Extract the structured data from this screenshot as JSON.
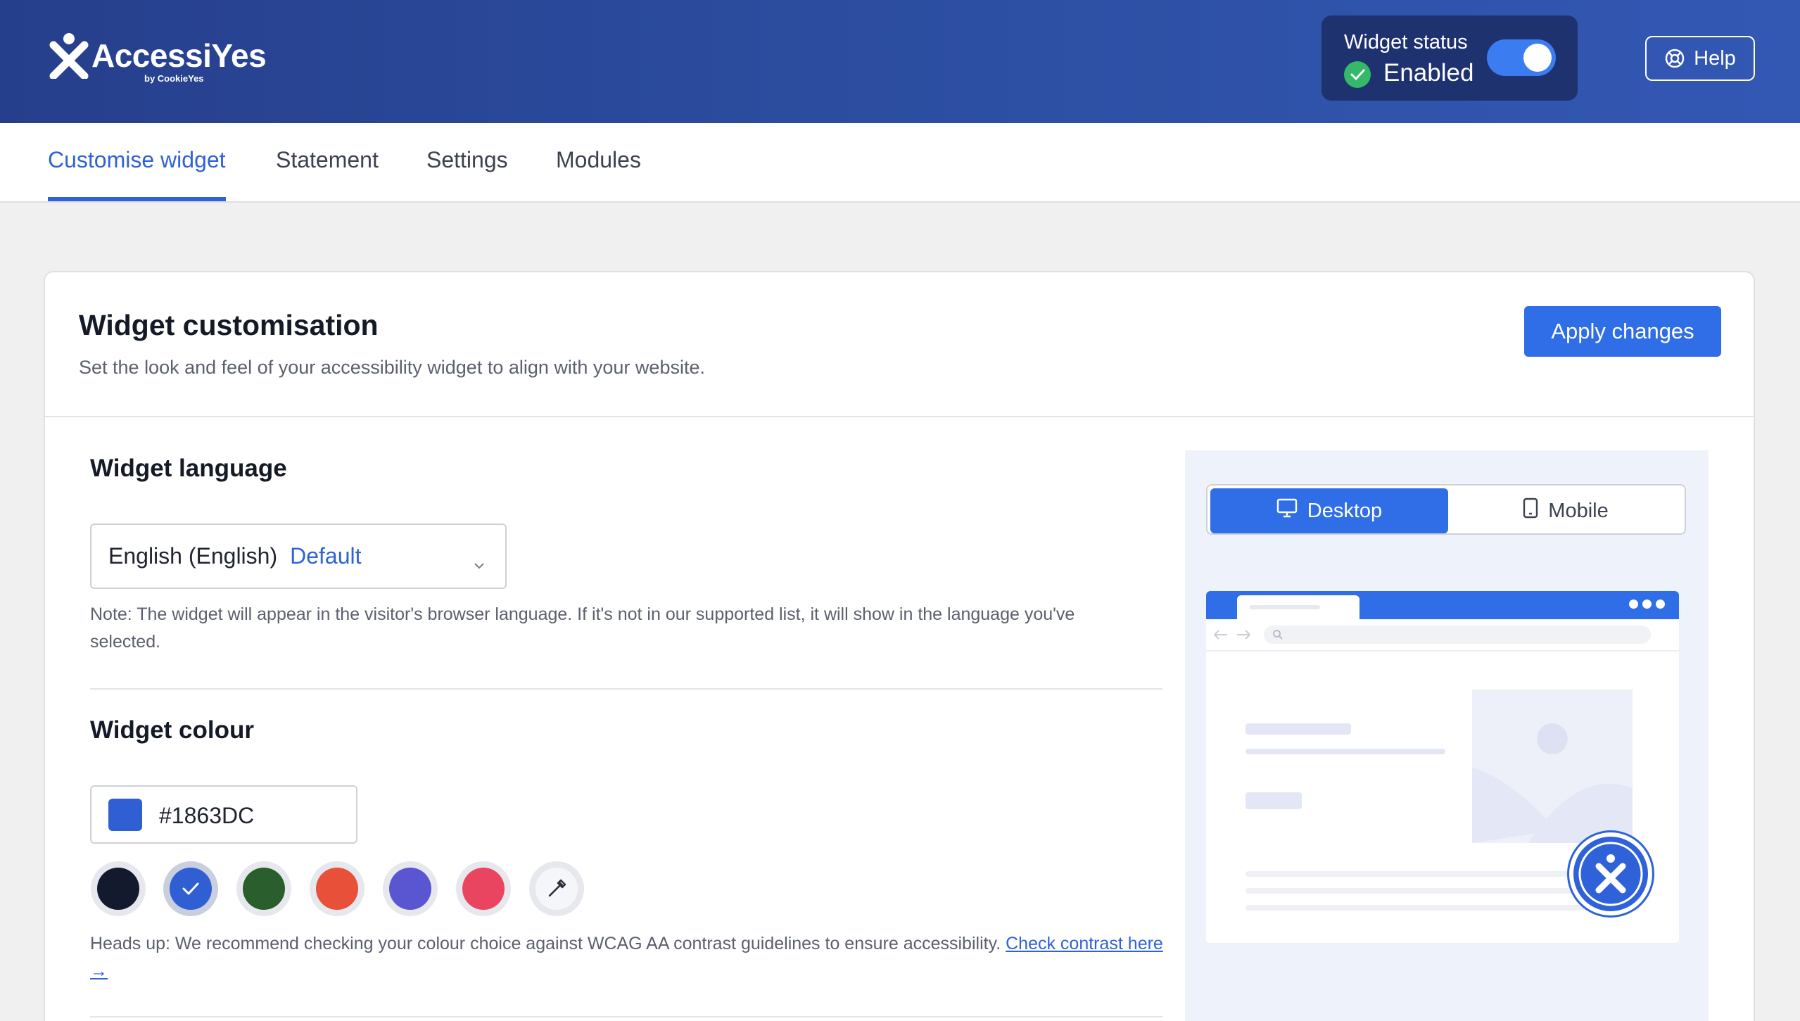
{
  "header": {
    "logo_text": "AccessiYes",
    "logo_sub": "by CookieYes",
    "widget_status_label": "Widget status",
    "widget_status_value": "Enabled",
    "help_label": "Help"
  },
  "tabs": [
    {
      "label": "Customise widget",
      "active": true
    },
    {
      "label": "Statement",
      "active": false
    },
    {
      "label": "Settings",
      "active": false
    },
    {
      "label": "Modules",
      "active": false
    }
  ],
  "card": {
    "title": "Widget customisation",
    "subtitle": "Set the look and feel of your accessibility widget to align with your website.",
    "apply_label": "Apply changes"
  },
  "language": {
    "title": "Widget language",
    "selected": "English (English)",
    "default_tag": "Default",
    "note": "Note: The widget will appear in the visitor's browser language. If it's not in our supported list, it will show in the language you've selected."
  },
  "colour": {
    "title": "Widget colour",
    "value": "#1863DC",
    "swatches": [
      "#141a2e",
      "#2f5fd3",
      "#2a5e2c",
      "#e8503a",
      "#5a56d2",
      "#e94560"
    ],
    "selected_index": 1,
    "picker_icon": "eyedropper-icon",
    "heads_up": "Heads up: We recommend checking your colour choice against WCAG AA contrast guidelines to ensure accessibility.",
    "check_link": "Check contrast here →"
  },
  "preview": {
    "desktop_label": "Desktop",
    "mobile_label": "Mobile",
    "active_device": "Desktop"
  },
  "colors": {
    "header_bg": "#2d4fa3",
    "accent": "#2f6ee6",
    "status_green": "#34b96a"
  }
}
